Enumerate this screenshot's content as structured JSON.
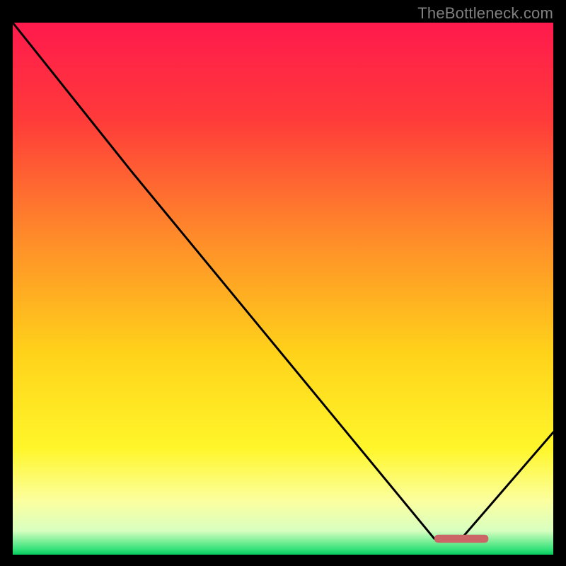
{
  "watermark": "TheBottleneck.com",
  "chart_data": {
    "type": "line",
    "title": "",
    "xlabel": "",
    "ylabel": "",
    "xlim": [
      0,
      100
    ],
    "ylim": [
      0,
      100
    ],
    "grid": false,
    "series": [
      {
        "name": "curve",
        "color": "#000000",
        "x": [
          0,
          22,
          78,
          83,
          100
        ],
        "y": [
          100,
          72,
          3,
          3,
          23
        ]
      }
    ],
    "marker": {
      "name": "highlight-segment",
      "color": "#cc6666",
      "x_start": 78,
      "x_end": 88,
      "y": 3,
      "thickness": 1.5
    },
    "background_gradient": {
      "stops": [
        {
          "offset": 0.0,
          "color": "#ff1a4d"
        },
        {
          "offset": 0.18,
          "color": "#ff3a3a"
        },
        {
          "offset": 0.4,
          "color": "#ff8a2a"
        },
        {
          "offset": 0.62,
          "color": "#ffd21a"
        },
        {
          "offset": 0.8,
          "color": "#fff62a"
        },
        {
          "offset": 0.9,
          "color": "#fbffa0"
        },
        {
          "offset": 0.955,
          "color": "#d8ffc0"
        },
        {
          "offset": 0.99,
          "color": "#34e27a"
        },
        {
          "offset": 1.0,
          "color": "#06c95e"
        }
      ]
    }
  }
}
